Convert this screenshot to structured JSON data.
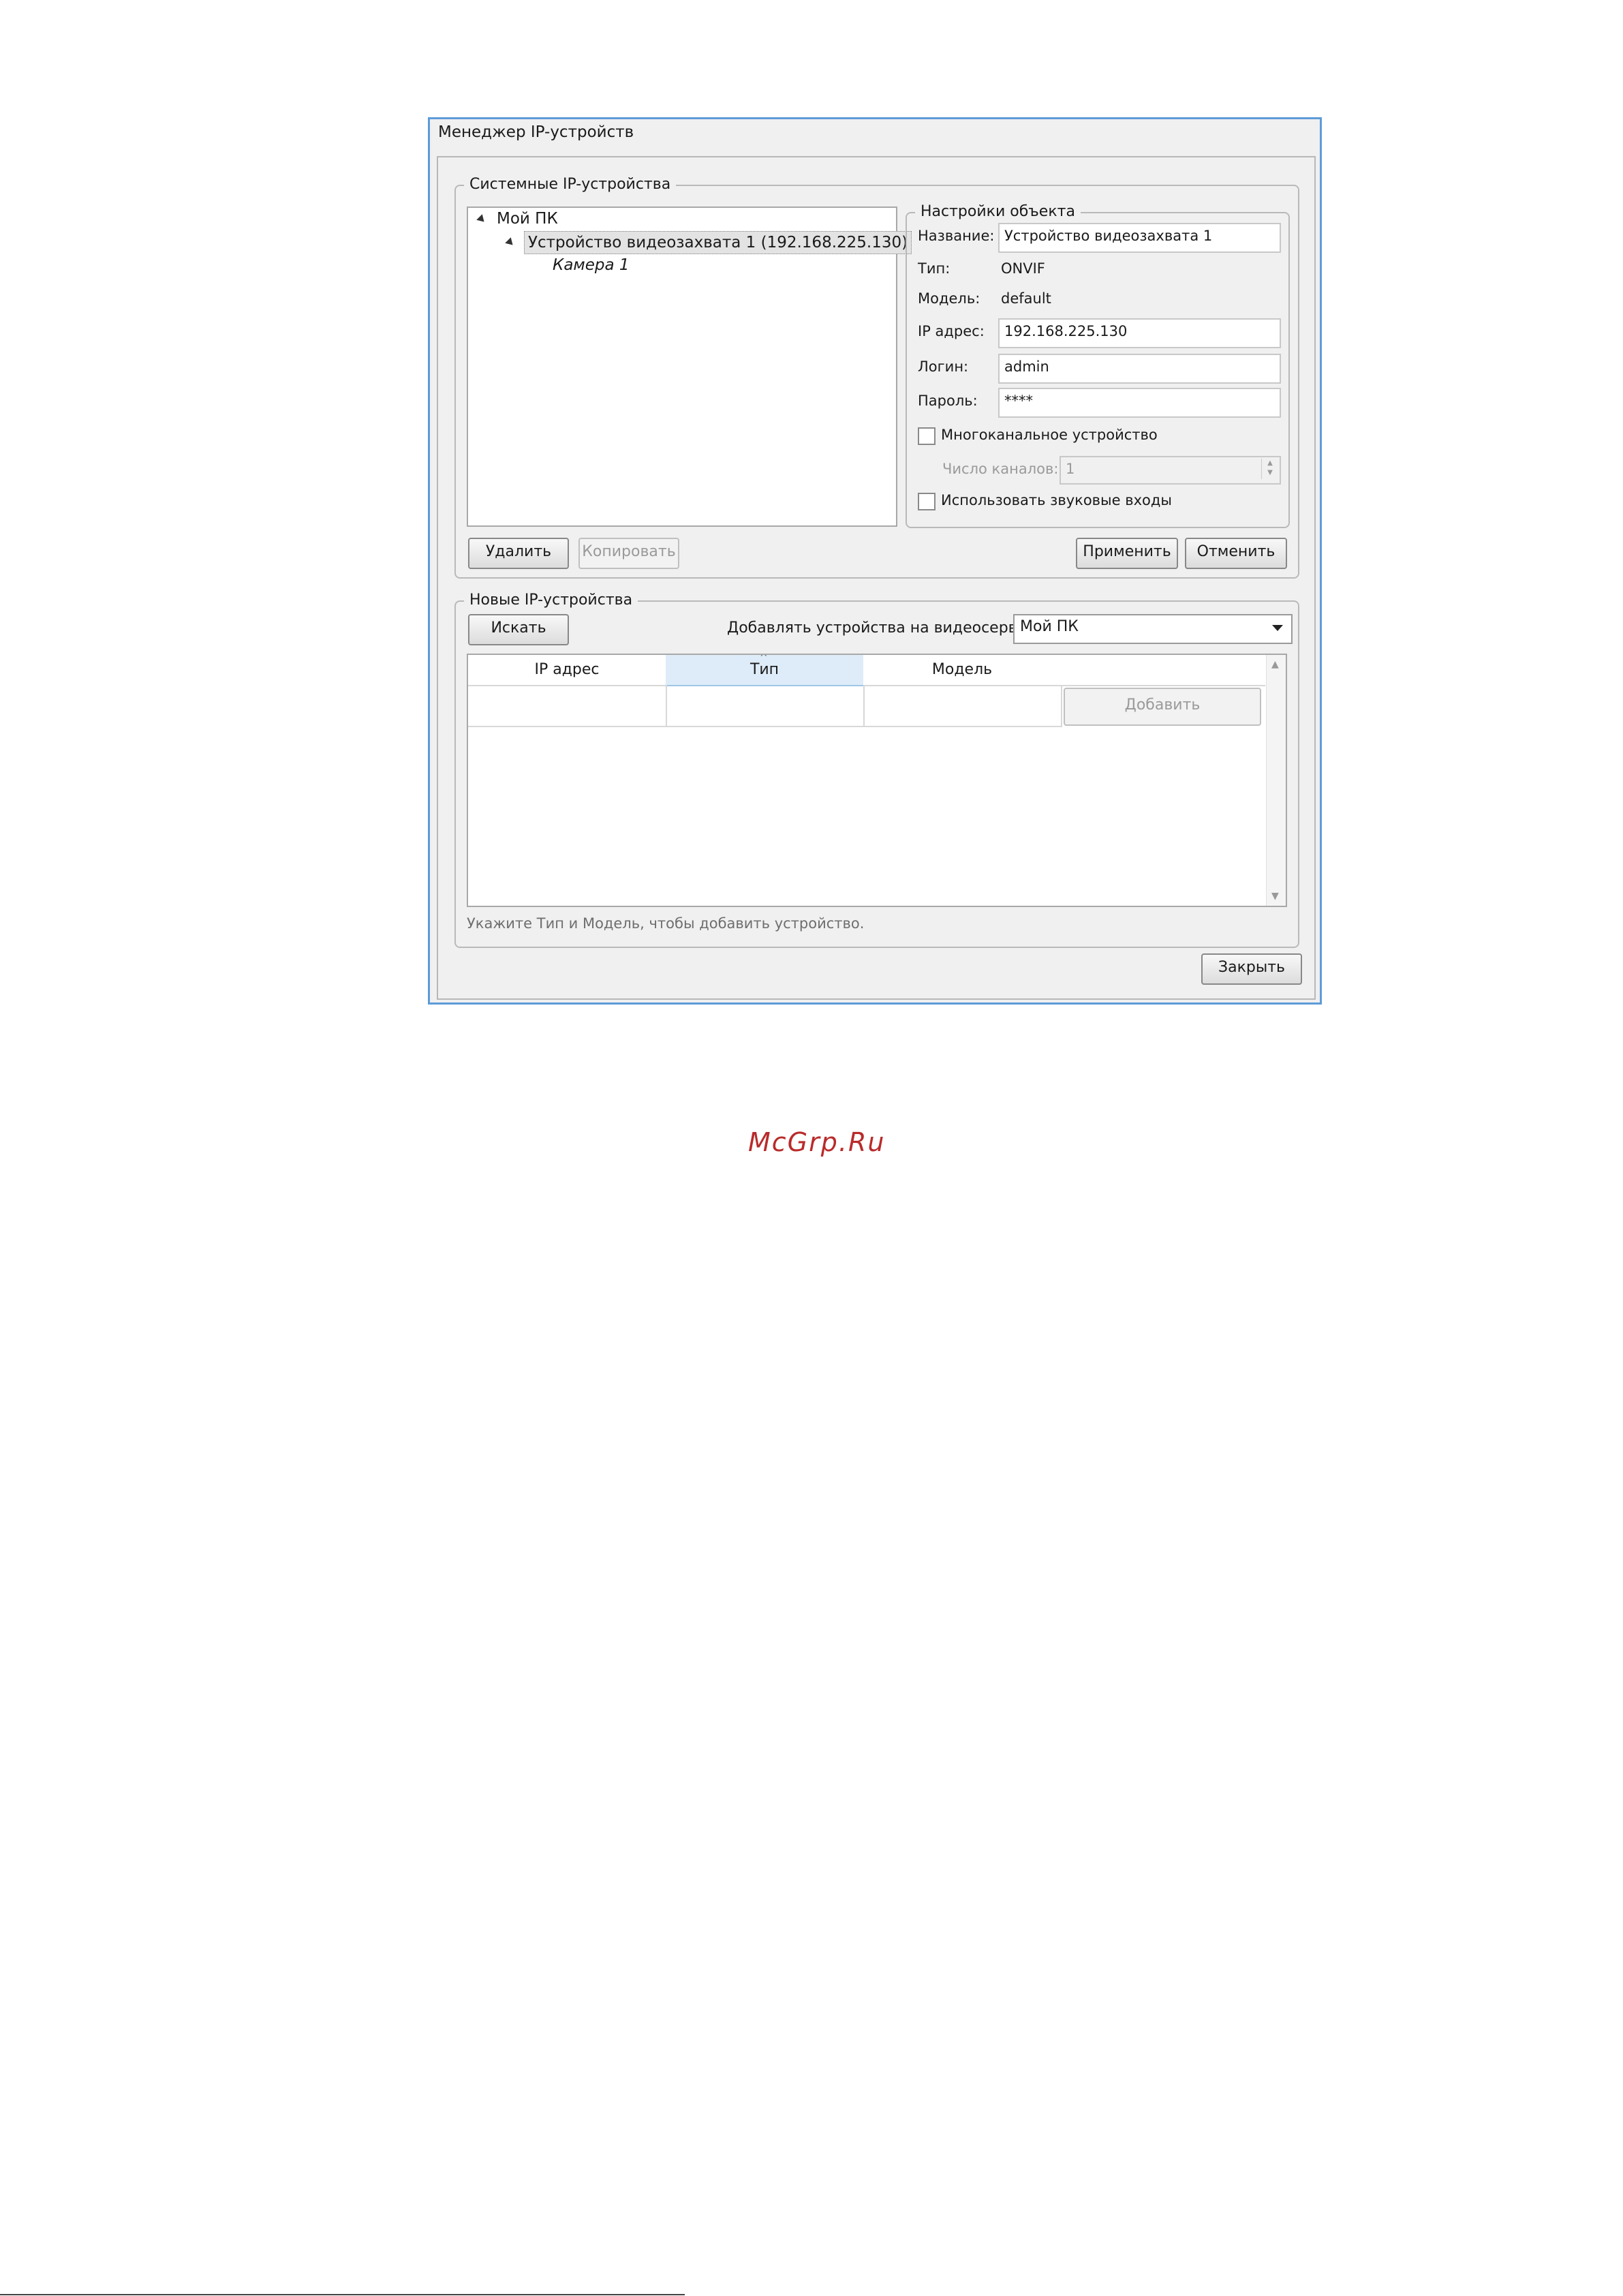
{
  "window": {
    "title": "Менеджер IP-устройств"
  },
  "system_devices": {
    "legend": "Системные IP-устройства",
    "tree": {
      "root": "Мой ПК",
      "device": "Устройство видеозахвата 1 (192.168.225.130)",
      "camera": "Камера 1"
    },
    "delete_label": "Удалить",
    "copy_label": "Копировать",
    "apply_label": "Применить",
    "cancel_label": "Отменить"
  },
  "object_settings": {
    "legend": "Настройки объекта",
    "name_label": "Название:",
    "name_value": "Устройство видеозахвата 1",
    "type_label": "Тип:",
    "type_value": "ONVIF",
    "model_label": "Модель:",
    "model_value": "default",
    "ip_label": "IP адрес:",
    "ip_value": "192.168.225.130",
    "login_label": "Логин:",
    "login_value": "admin",
    "password_label": "Пароль:",
    "password_value": "****",
    "multichannel_label": "Многоканальное устройство",
    "channels_label": "Число каналов:",
    "channels_value": "1",
    "audio_label": "Использовать звуковые входы"
  },
  "new_devices": {
    "legend": "Новые IP-устройства",
    "search_label": "Искать",
    "add_to_server_label": "Добавлять устройства на видеосервер:",
    "server_value": "Мой ПК",
    "columns": [
      "IP адрес",
      "Тип",
      "Модель"
    ],
    "add_label": "Добавить",
    "hint": "Укажите Тип и Модель, чтобы добавить устройство."
  },
  "close_label": "Закрыть",
  "watermark": "McGrp.Ru"
}
